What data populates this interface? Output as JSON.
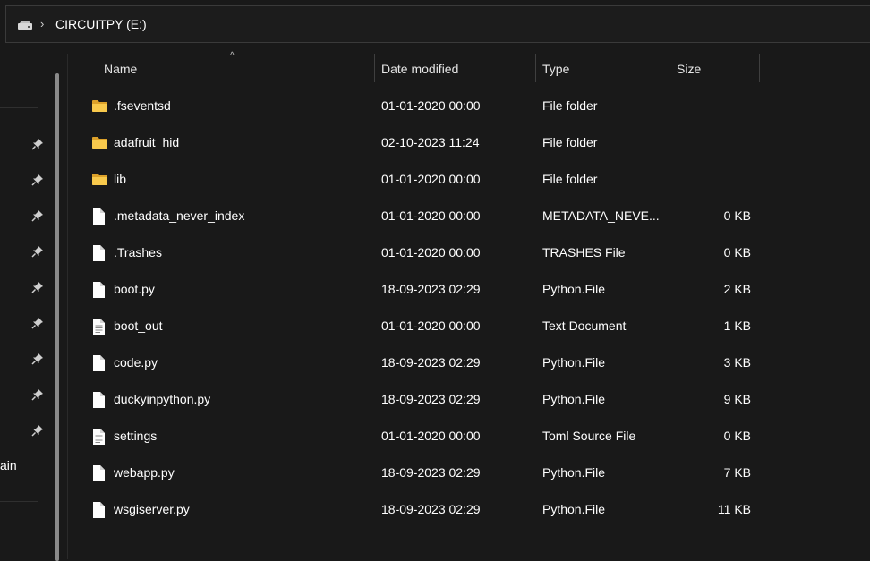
{
  "address": {
    "drive_icon": "drive-icon",
    "separator": "›",
    "path": "CIRCUITPY (E:)"
  },
  "sidebar": {
    "partial_label": "ain",
    "pin_icon": "pin-icon"
  },
  "columns": {
    "name": "Name",
    "date": "Date modified",
    "type": "Type",
    "size": "Size",
    "sort_indicator": "^"
  },
  "files": [
    {
      "icon": "folder-icon",
      "name": ".fseventsd",
      "date": "01-01-2020 00:00",
      "type": "File folder",
      "size": ""
    },
    {
      "icon": "folder-icon",
      "name": "adafruit_hid",
      "date": "02-10-2023 11:24",
      "type": "File folder",
      "size": ""
    },
    {
      "icon": "folder-icon",
      "name": "lib",
      "date": "01-01-2020 00:00",
      "type": "File folder",
      "size": ""
    },
    {
      "icon": "file-icon",
      "name": ".metadata_never_index",
      "date": "01-01-2020 00:00",
      "type": "METADATA_NEVE...",
      "size": "0 KB"
    },
    {
      "icon": "file-icon",
      "name": ".Trashes",
      "date": "01-01-2020 00:00",
      "type": "TRASHES File",
      "size": "0 KB"
    },
    {
      "icon": "file-icon",
      "name": "boot.py",
      "date": "18-09-2023 02:29",
      "type": "Python.File",
      "size": "2 KB"
    },
    {
      "icon": "text-file-icon",
      "name": "boot_out",
      "date": "01-01-2020 00:00",
      "type": "Text Document",
      "size": "1 KB"
    },
    {
      "icon": "file-icon",
      "name": "code.py",
      "date": "18-09-2023 02:29",
      "type": "Python.File",
      "size": "3 KB"
    },
    {
      "icon": "file-icon",
      "name": "duckyinpython.py",
      "date": "18-09-2023 02:29",
      "type": "Python.File",
      "size": "9 KB"
    },
    {
      "icon": "text-file-icon",
      "name": "settings",
      "date": "01-01-2020 00:00",
      "type": "Toml Source File",
      "size": "0 KB"
    },
    {
      "icon": "file-icon",
      "name": "webapp.py",
      "date": "18-09-2023 02:29",
      "type": "Python.File",
      "size": "7 KB"
    },
    {
      "icon": "file-icon",
      "name": "wsgiserver.py",
      "date": "18-09-2023 02:29",
      "type": "Python.File",
      "size": "11 KB"
    }
  ],
  "colors": {
    "background": "#191919",
    "folder": "#f4c542",
    "text": "#ffffff"
  }
}
